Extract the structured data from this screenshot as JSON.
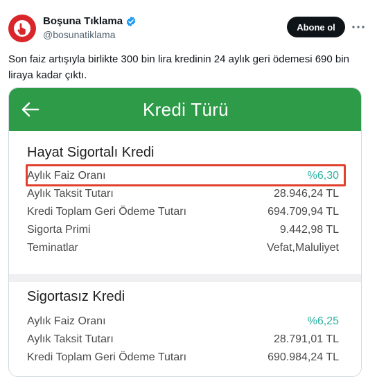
{
  "author": {
    "display_name": "Boşuna Tıklama",
    "handle": "@bosunatiklama"
  },
  "actions": {
    "follow_label": "Abone ol"
  },
  "tweet": {
    "text": "Son faiz artışıyla birlikte 300 bin lira kredinin 24 aylık geri ödemesi 690 bin liraya kadar çıktı."
  },
  "media": {
    "app_bar_title": "Kredi Türü",
    "colors": {
      "app_bar": "#2e9b48",
      "accent_rate": "#2bb1a0",
      "highlight": "#e0402c"
    },
    "insured": {
      "title": "Hayat Sigortalı Kredi",
      "rows": [
        {
          "label": "Aylık Faiz Oranı",
          "value": "%6,30"
        },
        {
          "label": "Aylık Taksit Tutarı",
          "value": "28.946,24 TL"
        },
        {
          "label": "Kredi Toplam Geri Ödeme Tutarı",
          "value": "694.709,94 TL"
        },
        {
          "label": "Sigorta Primi",
          "value": "9.442,98 TL"
        },
        {
          "label": "Teminatlar",
          "value": "Vefat,Maluliyet"
        }
      ]
    },
    "uninsured": {
      "title": "Sigortasız Kredi",
      "rows": [
        {
          "label": "Aylık Faiz Oranı",
          "value": "%6,25"
        },
        {
          "label": "Aylık Taksit Tutarı",
          "value": "28.791,01 TL"
        },
        {
          "label": "Kredi Toplam Geri Ödeme Tutarı",
          "value": "690.984,24 TL"
        }
      ]
    }
  }
}
